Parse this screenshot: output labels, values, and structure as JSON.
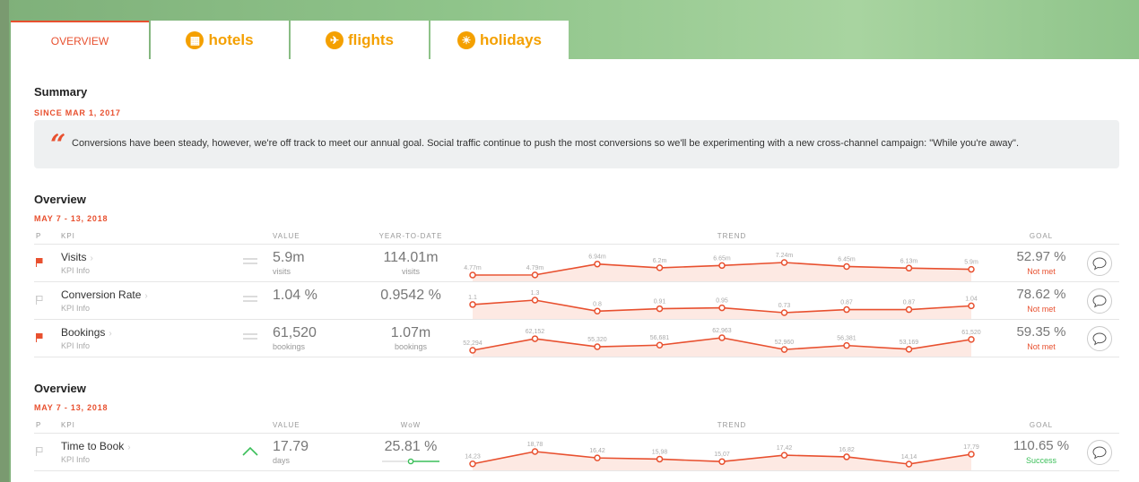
{
  "colors": {
    "accent": "#e8502f",
    "brand": "#f4a000",
    "success": "#3cbf5a",
    "muted": "#999999"
  },
  "tabs": [
    {
      "label": "OVERVIEW",
      "icon": "none"
    },
    {
      "label": "hotels",
      "icon": "hotel-icon"
    },
    {
      "label": "flights",
      "icon": "plane-icon"
    },
    {
      "label": "holidays",
      "icon": "beach-icon"
    }
  ],
  "summary": {
    "title": "Summary",
    "since": "SINCE MAR 1, 2017",
    "quote": "Conversions have been steady, however, we're off track to meet our annual goal. Social traffic continue to push the most conversions so we'll be experimenting with a new cross-channel campaign: \"While you're away\"."
  },
  "overview1": {
    "title": "Overview",
    "date": "MAY 7 - 13, 2018",
    "headers": {
      "flag": "P",
      "kpi": "KPI",
      "value": "VALUE",
      "ytd": "YEAR-TO-DATE",
      "trend": "TREND",
      "goal": "GOAL"
    },
    "rows": [
      {
        "flagged": true,
        "name": "Visits",
        "info": "KPI Info",
        "trend_dir": "flat",
        "value": "5.9m",
        "value_unit": "visits",
        "ytd": "114.01m",
        "ytd_unit": "visits",
        "trend_values": [
          4.77,
          4.79,
          6.94,
          6.2,
          6.65,
          7.24,
          6.45,
          6.13,
          5.9
        ],
        "trend_labels": [
          "4.77m",
          "4.79m",
          "6.94m",
          "6.2m",
          "6.65m",
          "7.24m",
          "6.45m",
          "6.13m",
          "5.9m"
        ],
        "goal": "52.97 %",
        "goal_status": "Not met",
        "goal_met": false
      },
      {
        "flagged": false,
        "name": "Conversion Rate",
        "info": "KPI Info",
        "trend_dir": "flat",
        "value": "1.04 %",
        "value_unit": "",
        "ytd": "0.9542 %",
        "ytd_unit": "",
        "trend_values": [
          1.1,
          1.3,
          0.8,
          0.91,
          0.95,
          0.73,
          0.87,
          0.87,
          1.04
        ],
        "trend_labels": [
          "1.1",
          "1.3",
          "0.8",
          "0.91",
          "0.95",
          "0.73",
          "0.87",
          "0.87",
          "1.04"
        ],
        "goal": "78.62 %",
        "goal_status": "Not met",
        "goal_met": false
      },
      {
        "flagged": true,
        "name": "Bookings",
        "info": "KPI Info",
        "trend_dir": "flat",
        "value": "61,520",
        "value_unit": "bookings",
        "ytd": "1.07m",
        "ytd_unit": "bookings",
        "trend_values": [
          52294,
          62152,
          55320,
          56681,
          62963,
          52960,
          56381,
          53169,
          61520
        ],
        "trend_labels": [
          "52,294",
          "62,152",
          "55,320",
          "56,681",
          "62,963",
          "52,960",
          "56,381",
          "53,169",
          "61,520"
        ],
        "goal": "59.35 %",
        "goal_status": "Not met",
        "goal_met": false
      }
    ]
  },
  "overview2": {
    "title": "Overview",
    "date": "MAY 7 - 13, 2018",
    "headers": {
      "flag": "P",
      "kpi": "KPI",
      "value": "VALUE",
      "ytd": "WoW",
      "trend": "TREND",
      "goal": "GOAL"
    },
    "rows": [
      {
        "flagged": false,
        "name": "Time to Book",
        "info": "KPI Info",
        "trend_dir": "up",
        "value": "17.79",
        "value_unit": "days",
        "ytd": "25.81 %",
        "ytd_unit": "",
        "wow_progress": 0.5,
        "trend_values": [
          14.23,
          18.78,
          16.42,
          15.98,
          15.07,
          17.42,
          16.82,
          14.14,
          17.79
        ],
        "trend_labels": [
          "14,23",
          "18,78",
          "16,42",
          "15,98",
          "15,07",
          "17,42",
          "16,82",
          "14,14",
          "17,79"
        ],
        "goal": "110.65 %",
        "goal_status": "Success",
        "goal_met": true
      }
    ]
  }
}
